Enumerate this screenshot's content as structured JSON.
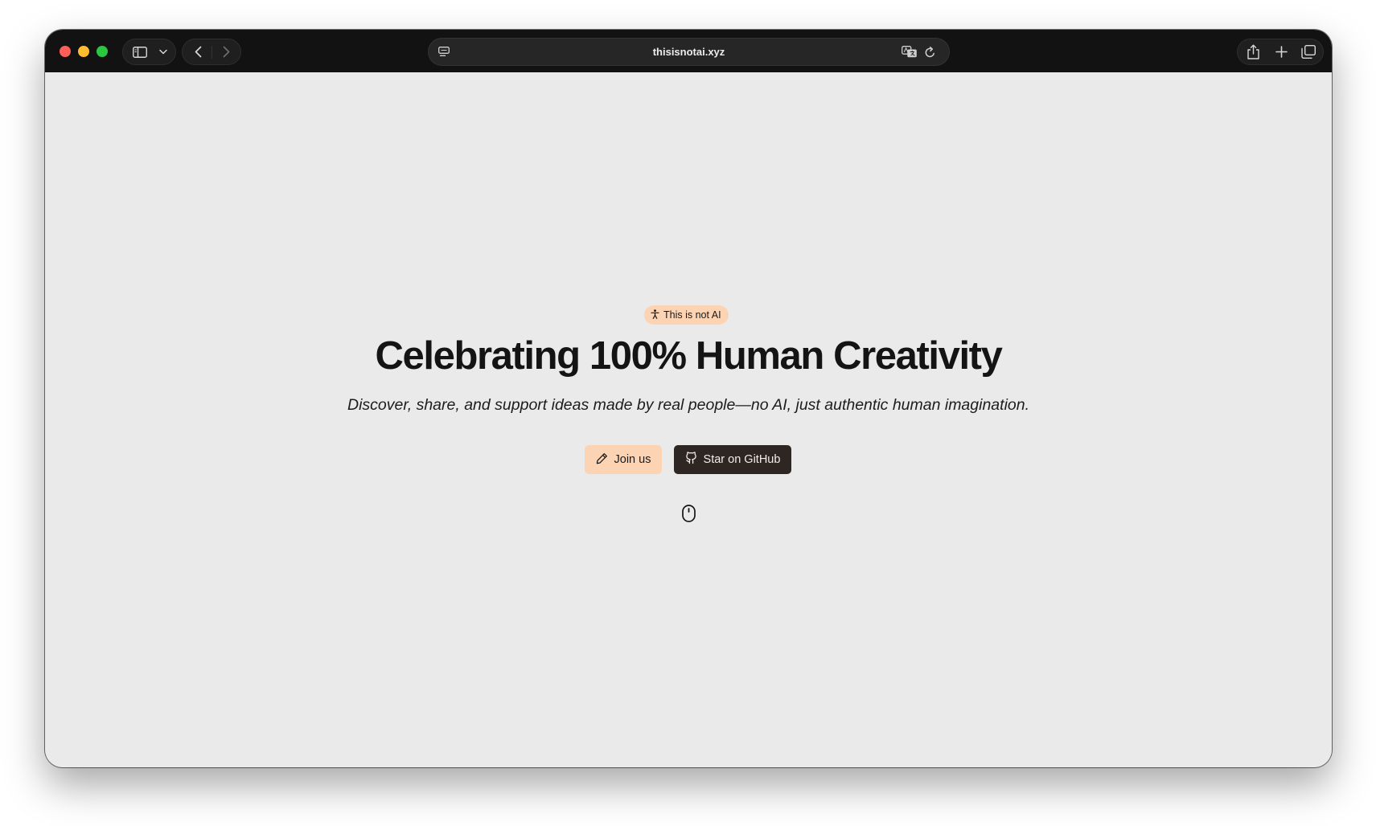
{
  "browser": {
    "url": "thisisnotai.xyz",
    "icons": {
      "sidebar": "sidebar-icon",
      "chevron": "chevron-down-icon",
      "back": "back-icon",
      "forward": "forward-icon",
      "page_menu": "page-menu-icon",
      "translate": "translate-icon",
      "reload": "reload-icon",
      "share": "share-icon",
      "new_tab": "plus-icon",
      "tabs": "tab-overview-icon"
    }
  },
  "hero": {
    "badge": "This is not AI",
    "title": "Celebrating 100% Human Creativity",
    "subtitle": "Discover, share, and support ideas made by real people—no AI, just authentic human imagination.",
    "join_label": "Join us",
    "github_label": "Star on GitHub"
  },
  "colors": {
    "page_bg": "#eaeaea",
    "accent_peach": "#fdd4b3",
    "dark_button": "#2e2622",
    "titlebar": "#121212"
  }
}
